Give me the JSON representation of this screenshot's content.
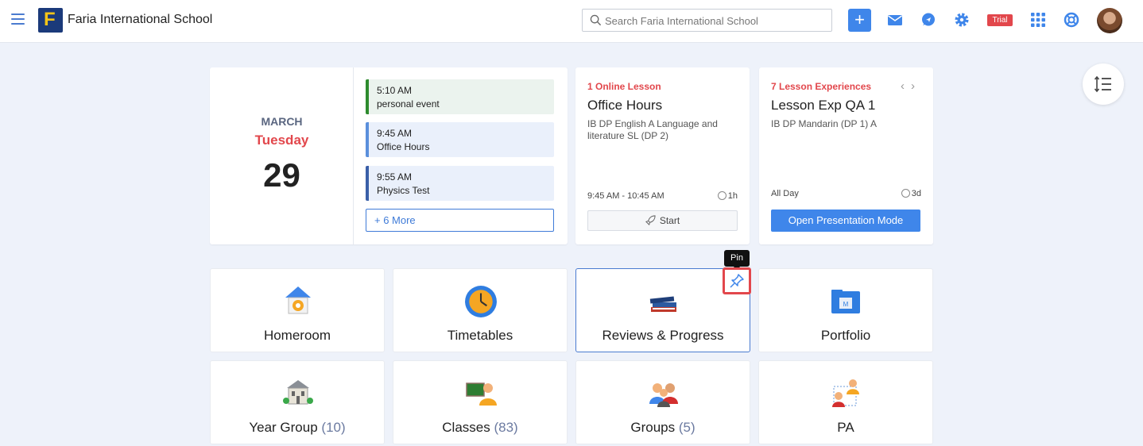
{
  "header": {
    "school_name": "Faria International School",
    "logo_letter": "F",
    "search_placeholder": "Search Faria International School",
    "plus_label": "+",
    "trial_label": "Trial",
    "icons": [
      "menu-icon",
      "mail-icon",
      "chat-icon",
      "gear-icon",
      "apps-grid-icon",
      "help-icon",
      "avatar"
    ]
  },
  "calendar": {
    "month": "MARCH",
    "weekday": "Tuesday",
    "day": "29",
    "events": [
      {
        "time": "5:10 AM",
        "title": "personal event"
      },
      {
        "time": "9:45 AM",
        "title": "Office Hours"
      },
      {
        "time": "9:55 AM",
        "title": "Physics Test"
      }
    ],
    "more_label": "+ 6 More"
  },
  "lesson1": {
    "tag": "1 Online Lesson",
    "title": "Office Hours",
    "subtitle": "IB DP English A Language and literature SL (DP 2)",
    "time": "9:45 AM - 10:45 AM",
    "duration": "1h",
    "button": "Start"
  },
  "lesson2": {
    "tag": "7 Lesson Experiences",
    "title": "Lesson Exp QA 1",
    "subtitle": "IB DP Mandarin (DP 1) A",
    "time": "All Day",
    "duration": "3d",
    "button": "Open Presentation Mode"
  },
  "tooltip": "Pin",
  "tiles": [
    {
      "label": "Homeroom",
      "count": ""
    },
    {
      "label": "Timetables",
      "count": ""
    },
    {
      "label": "Reviews & Progress",
      "count": ""
    },
    {
      "label": "Portfolio",
      "count": ""
    },
    {
      "label": "Year Group",
      "count": "(10)"
    },
    {
      "label": "Classes",
      "count": "(83)"
    },
    {
      "label": "Groups",
      "count": "(5)"
    },
    {
      "label": "PA",
      "count": ""
    }
  ],
  "colors": {
    "accent": "#3f86ea",
    "alert": "#e2474c",
    "background": "#eef2fa"
  }
}
